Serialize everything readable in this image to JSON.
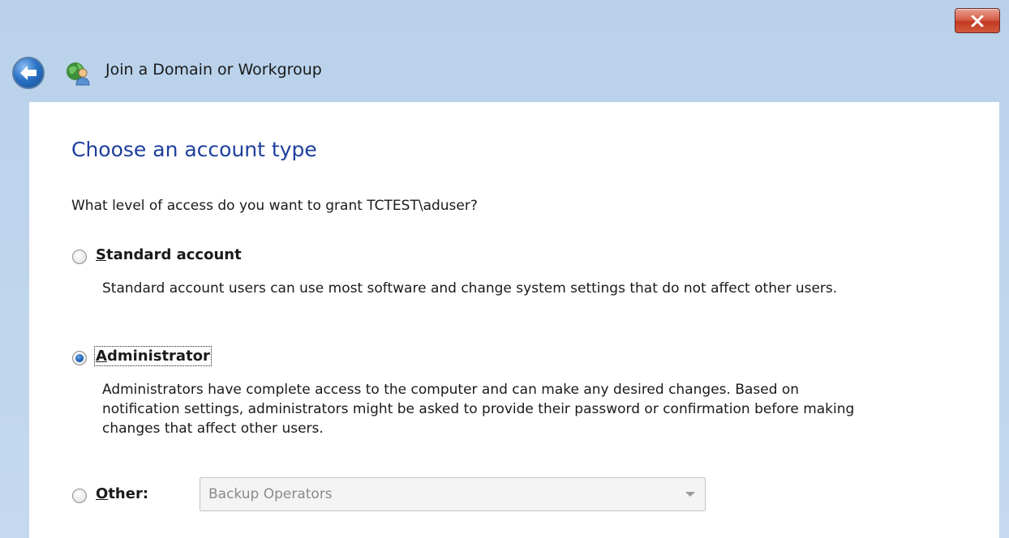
{
  "window": {
    "title": "Join a Domain or Workgroup",
    "close_icon": "close-icon",
    "back_icon": "back-arrow-icon",
    "title_icon": "network-user-icon"
  },
  "page": {
    "heading": "Choose an account type",
    "question": "What level of access do you want to grant TCTEST\\aduser?"
  },
  "options": [
    {
      "id": "standard",
      "label": "Standard account",
      "mnemonic": "S",
      "rest": "tandard account",
      "checked": false,
      "description": "Standard account users can use most software and change system settings that do not affect other users."
    },
    {
      "id": "administrator",
      "label": "Administrator",
      "mnemonic": "A",
      "rest": "dministrator",
      "checked": true,
      "description": "Administrators have complete access to the computer and can make any desired changes. Based on notification settings, administrators might be asked to provide their password or confirmation before making changes that affect other users."
    },
    {
      "id": "other",
      "label": "Other:",
      "mnemonic": "O",
      "rest": "ther:",
      "checked": false,
      "select_value": "Backup Operators",
      "select_enabled": false
    }
  ],
  "colors": {
    "heading": "#1e3f9c",
    "frame": "#b9d1ea",
    "close_button": "#c23a22"
  }
}
